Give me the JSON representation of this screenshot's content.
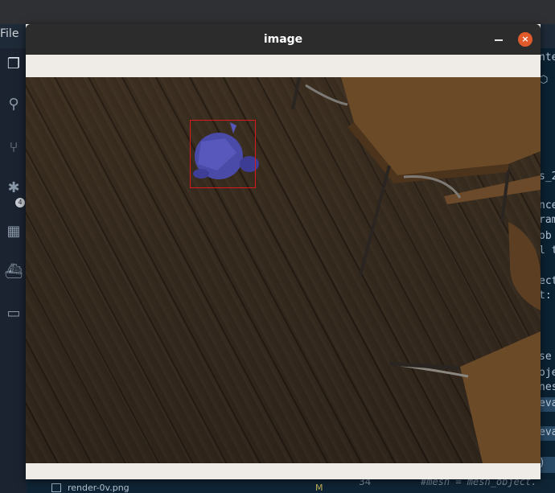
{
  "menu": {
    "file_label": "File"
  },
  "activity_bar": {
    "items": [
      "files-icon",
      "search-icon",
      "source-control-icon",
      "debug-icon",
      "extensions-icon",
      "docker-icon",
      "remote-explorer-icon"
    ],
    "badge_count": "4"
  },
  "editor_bg_code": {
    "lines": [
      "nte",
      "",
      "",
      "s_2",
      "",
      "nce",
      "ram",
      "ob",
      "l t",
      "",
      "ect",
      "t:",
      "",
      "",
      "",
      "se",
      "oje",
      "nes",
      "eva",
      "",
      "eva",
      "",
      ")"
    ]
  },
  "explorer_item": {
    "name": "render-0v.png",
    "status": "M",
    "line_number": "34"
  },
  "bottom_code": "#mesh = mesh_object.",
  "image_window": {
    "title": "image",
    "minimize_label": "",
    "close_label": "×"
  },
  "colors": {
    "close_button": "#e05a2b",
    "bbox_stroke": "#d81a1a",
    "object_fill": "#4a4aa8"
  }
}
